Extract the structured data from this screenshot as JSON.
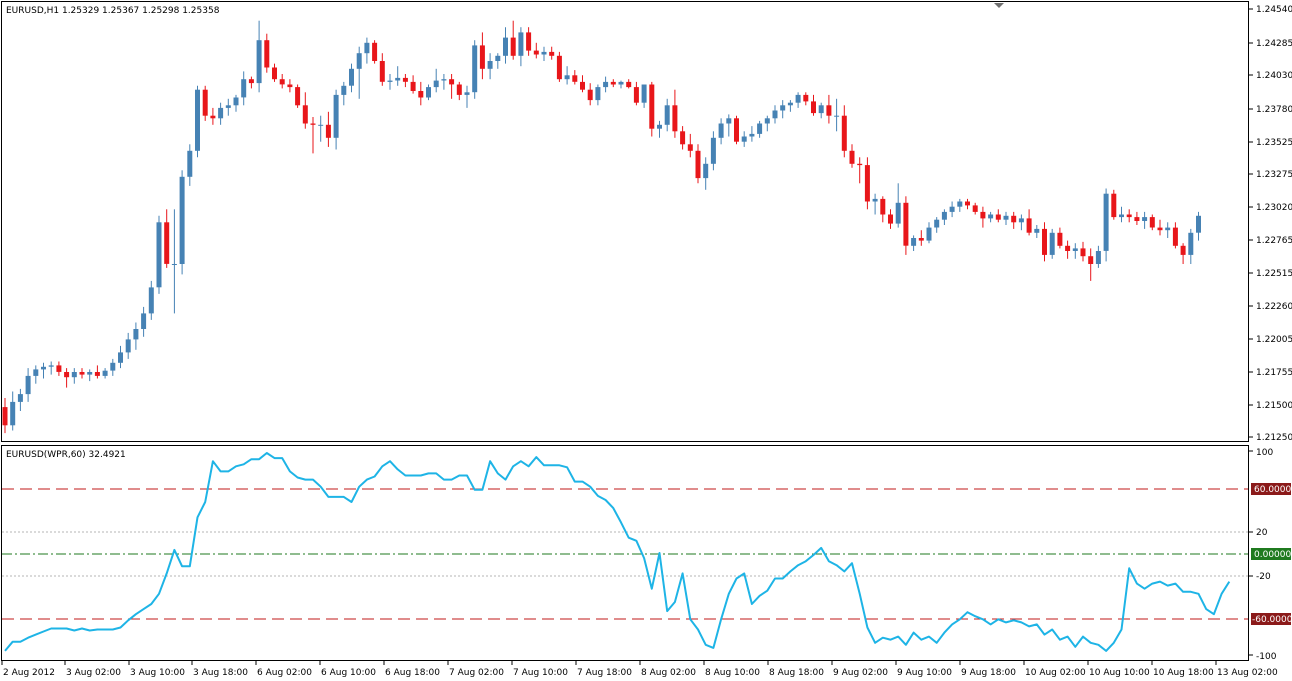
{
  "main_panel": {
    "label": "EURUSD,H1  1.25329 1.25367 1.25298 1.25358",
    "price_ticks": [
      "1.24540",
      "1.24285",
      "1.24030",
      "1.23780",
      "1.23525",
      "1.23275",
      "1.23020",
      "1.22765",
      "1.22515",
      "1.22260",
      "1.22005",
      "1.21755",
      "1.21500",
      "1.21250"
    ]
  },
  "indicator_panel": {
    "label": "EURUSD(WPR,60) 32.4921",
    "ticks": [
      "100",
      "20",
      "-20",
      "-100"
    ],
    "level_tags": [
      {
        "text": "60.0000",
        "value": 60,
        "color": "#8b1a1a"
      },
      {
        "text": "0.00000",
        "value": 0,
        "color": "#1f7a1f"
      },
      {
        "text": "-60.0000",
        "value": -60,
        "color": "#8b1a1a"
      }
    ]
  },
  "time_axis": [
    "2 Aug 2012",
    "3 Aug 02:00",
    "3 Aug 10:00",
    "3 Aug 18:00",
    "6 Aug 02:00",
    "6 Aug 10:00",
    "6 Aug 18:00",
    "7 Aug 02:00",
    "7 Aug 10:00",
    "7 Aug 18:00",
    "8 Aug 02:00",
    "8 Aug 10:00",
    "8 Aug 18:00",
    "9 Aug 02:00",
    "9 Aug 10:00",
    "9 Aug 18:00",
    "10 Aug 02:00",
    "10 Aug 10:00",
    "10 Aug 18:00",
    "13 Aug 02:00"
  ],
  "colors": {
    "bull": "#4682b4",
    "bear": "#e8161a",
    "wpr_line": "#1eb4e6",
    "level_red": "#c01818",
    "level_green": "#1f7a1f",
    "grid_dotted": "#b4b4b4",
    "frame": "#000000"
  },
  "chart_data": [
    {
      "type": "candlestick",
      "symbol": "EURUSD",
      "timeframe": "H1",
      "ylim": [
        1.2125,
        1.2454
      ],
      "x_labels": [
        "2 Aug 2012",
        "3 Aug 02:00",
        "3 Aug 10:00",
        "3 Aug 18:00",
        "6 Aug 02:00",
        "6 Aug 10:00",
        "6 Aug 18:00",
        "7 Aug 02:00",
        "7 Aug 10:00",
        "7 Aug 18:00",
        "8 Aug 02:00",
        "8 Aug 10:00",
        "8 Aug 18:00",
        "9 Aug 02:00",
        "9 Aug 10:00",
        "9 Aug 18:00",
        "10 Aug 02:00",
        "10 Aug 10:00",
        "10 Aug 18:00",
        "13 Aug 02:00"
      ],
      "ohlc": [
        [
          1.2148,
          1.2155,
          1.2128,
          1.2134
        ],
        [
          1.2134,
          1.216,
          1.213,
          1.2152
        ],
        [
          1.2152,
          1.2162,
          1.2145,
          1.2158
        ],
        [
          1.2158,
          1.2178,
          1.2152,
          1.2172
        ],
        [
          1.2172,
          1.218,
          1.2166,
          1.2177
        ],
        [
          1.2177,
          1.2182,
          1.217,
          1.2179
        ],
        [
          1.2179,
          1.2183,
          1.2173,
          1.218
        ],
        [
          1.218,
          1.2183,
          1.2172,
          1.2175
        ],
        [
          1.2175,
          1.2178,
          1.2163,
          1.2171
        ],
        [
          1.2171,
          1.2178,
          1.2166,
          1.2175
        ],
        [
          1.2175,
          1.2178,
          1.217,
          1.2173
        ],
        [
          1.2173,
          1.2177,
          1.2168,
          1.2175
        ],
        [
          1.2175,
          1.218,
          1.217,
          1.2172
        ],
        [
          1.2172,
          1.2178,
          1.217,
          1.2176
        ],
        [
          1.2176,
          1.2185,
          1.2172,
          1.2182
        ],
        [
          1.2182,
          1.2195,
          1.2178,
          1.219
        ],
        [
          1.219,
          1.2205,
          1.2185,
          1.22
        ],
        [
          1.22,
          1.2213,
          1.2192,
          1.2208
        ],
        [
          1.2208,
          1.2225,
          1.2202,
          1.222
        ],
        [
          1.222,
          1.2245,
          1.2215,
          1.224
        ],
        [
          1.224,
          1.2295,
          1.2235,
          1.229
        ],
        [
          1.229,
          1.23,
          1.2255,
          1.2258
        ],
        [
          1.2258,
          1.23,
          1.222,
          1.2258
        ],
        [
          1.2258,
          1.233,
          1.225,
          1.2325
        ],
        [
          1.2325,
          1.235,
          1.2318,
          1.2345
        ],
        [
          1.2345,
          1.2395,
          1.234,
          1.2392
        ],
        [
          1.2392,
          1.2395,
          1.2368,
          1.2372
        ],
        [
          1.2372,
          1.2378,
          1.2365,
          1.237
        ],
        [
          1.237,
          1.2382,
          1.2365,
          1.2378
        ],
        [
          1.2378,
          1.2385,
          1.2372,
          1.238
        ],
        [
          1.238,
          1.2388,
          1.2375,
          1.2386
        ],
        [
          1.2386,
          1.2406,
          1.238,
          1.24
        ],
        [
          1.24,
          1.2402,
          1.2393,
          1.2397
        ],
        [
          1.2397,
          1.2445,
          1.239,
          1.243
        ],
        [
          1.243,
          1.2435,
          1.2405,
          1.2409
        ],
        [
          1.2409,
          1.2412,
          1.2398,
          1.24
        ],
        [
          1.24,
          1.2404,
          1.2393,
          1.2396
        ],
        [
          1.2396,
          1.24,
          1.239,
          1.2394
        ],
        [
          1.2394,
          1.2396,
          1.2378,
          1.238
        ],
        [
          1.238,
          1.239,
          1.2362,
          1.2366
        ],
        [
          1.2366,
          1.2371,
          1.2343,
          1.2365
        ],
        [
          1.2365,
          1.2372,
          1.2352,
          1.2365
        ],
        [
          1.2365,
          1.2375,
          1.2348,
          1.2355
        ],
        [
          1.2355,
          1.2392,
          1.2346,
          1.2388
        ],
        [
          1.2388,
          1.2398,
          1.238,
          1.2395
        ],
        [
          1.2395,
          1.2412,
          1.239,
          1.2408
        ],
        [
          1.2408,
          1.2425,
          1.2385,
          1.242
        ],
        [
          1.242,
          1.2432,
          1.2412,
          1.2428
        ],
        [
          1.2428,
          1.243,
          1.2412,
          1.2414
        ],
        [
          1.2414,
          1.242,
          1.2395,
          1.2398
        ],
        [
          1.2398,
          1.2404,
          1.2392,
          1.2399
        ],
        [
          1.2399,
          1.241,
          1.2395,
          1.2401
        ],
        [
          1.2401,
          1.2404,
          1.2394,
          1.2398
        ],
        [
          1.2398,
          1.2403,
          1.2389,
          1.2391
        ],
        [
          1.2391,
          1.2398,
          1.238,
          1.2386
        ],
        [
          1.2386,
          1.2396,
          1.2384,
          1.2394
        ],
        [
          1.2394,
          1.2408,
          1.239,
          1.2399
        ],
        [
          1.2399,
          1.2404,
          1.2392,
          1.24
        ],
        [
          1.24,
          1.2404,
          1.2385,
          1.2396
        ],
        [
          1.2396,
          1.2398,
          1.2384,
          1.2388
        ],
        [
          1.2388,
          1.2395,
          1.2378,
          1.239
        ],
        [
          1.239,
          1.243,
          1.2385,
          1.2426
        ],
        [
          1.2426,
          1.2436,
          1.24,
          1.2408
        ],
        [
          1.2408,
          1.242,
          1.24,
          1.2414
        ],
        [
          1.2414,
          1.242,
          1.2408,
          1.2418
        ],
        [
          1.2418,
          1.244,
          1.2412,
          1.2432
        ],
        [
          1.2432,
          1.2445,
          1.2415,
          1.2418
        ],
        [
          1.2418,
          1.244,
          1.241,
          1.2436
        ],
        [
          1.2436,
          1.244,
          1.2418,
          1.2422
        ],
        [
          1.2422,
          1.2428,
          1.2416,
          1.2419
        ],
        [
          1.2419,
          1.2425,
          1.2414,
          1.2421
        ],
        [
          1.2421,
          1.2425,
          1.2415,
          1.2418
        ],
        [
          1.2418,
          1.2421,
          1.2398,
          1.24
        ],
        [
          1.24,
          1.241,
          1.2396,
          1.2403
        ],
        [
          1.2403,
          1.2407,
          1.2396,
          1.2398
        ],
        [
          1.2398,
          1.2403,
          1.239,
          1.2392
        ],
        [
          1.2392,
          1.2397,
          1.238,
          1.2384
        ],
        [
          1.2384,
          1.2396,
          1.238,
          1.2394
        ],
        [
          1.2394,
          1.2402,
          1.239,
          1.2398
        ],
        [
          1.2398,
          1.24,
          1.2394,
          1.2396
        ],
        [
          1.2396,
          1.2399,
          1.2393,
          1.2398
        ],
        [
          1.2398,
          1.24,
          1.2393,
          1.2394
        ],
        [
          1.2394,
          1.2398,
          1.238,
          1.2382
        ],
        [
          1.2382,
          1.2396,
          1.2378,
          1.2396
        ],
        [
          1.2396,
          1.2398,
          1.2356,
          1.2362
        ],
        [
          1.2362,
          1.2368,
          1.2355,
          1.2365
        ],
        [
          1.2365,
          1.2385,
          1.236,
          1.238
        ],
        [
          1.238,
          1.2392,
          1.2355,
          1.236
        ],
        [
          1.236,
          1.2364,
          1.2346,
          1.235
        ],
        [
          1.235,
          1.2358,
          1.234,
          1.2345
        ],
        [
          1.2345,
          1.235,
          1.232,
          1.2324
        ],
        [
          1.2324,
          1.234,
          1.2315,
          1.2335
        ],
        [
          1.2335,
          1.236,
          1.233,
          1.2355
        ],
        [
          1.2355,
          1.237,
          1.235,
          1.2366
        ],
        [
          1.2366,
          1.2373,
          1.2356,
          1.237
        ],
        [
          1.237,
          1.2372,
          1.235,
          1.2352
        ],
        [
          1.2352,
          1.236,
          1.2348,
          1.2356
        ],
        [
          1.2356,
          1.2364,
          1.2352,
          1.2358
        ],
        [
          1.2358,
          1.2368,
          1.2355,
          1.2366
        ],
        [
          1.2366,
          1.2372,
          1.236,
          1.237
        ],
        [
          1.237,
          1.238,
          1.2366,
          1.2376
        ],
        [
          1.2376,
          1.2384,
          1.237,
          1.238
        ],
        [
          1.238,
          1.2384,
          1.2375,
          1.2382
        ],
        [
          1.2382,
          1.239,
          1.2378,
          1.2388
        ],
        [
          1.2388,
          1.239,
          1.238,
          1.2383
        ],
        [
          1.2383,
          1.2388,
          1.2372,
          1.2374
        ],
        [
          1.2374,
          1.2382,
          1.237,
          1.238
        ],
        [
          1.238,
          1.2388,
          1.2366,
          1.2372
        ],
        [
          1.2372,
          1.2385,
          1.236,
          1.2372
        ],
        [
          1.2372,
          1.238,
          1.234,
          1.2345
        ],
        [
          1.2345,
          1.235,
          1.2332,
          1.2335
        ],
        [
          1.2335,
          1.234,
          1.232,
          1.2334
        ],
        [
          1.2334,
          1.234,
          1.23,
          1.2306
        ],
        [
          1.2306,
          1.2312,
          1.2296,
          1.2308
        ],
        [
          1.2308,
          1.231,
          1.229,
          1.2296
        ],
        [
          1.2296,
          1.23,
          1.2285,
          1.2289
        ],
        [
          1.2289,
          1.232,
          1.2286,
          1.2305
        ],
        [
          1.2305,
          1.231,
          1.2265,
          1.2272
        ],
        [
          1.2272,
          1.228,
          1.2268,
          1.2278
        ],
        [
          1.2278,
          1.2284,
          1.2272,
          1.2276
        ],
        [
          1.2276,
          1.229,
          1.2274,
          1.2286
        ],
        [
          1.2286,
          1.2294,
          1.2282,
          1.2292
        ],
        [
          1.2292,
          1.23,
          1.2288,
          1.2298
        ],
        [
          1.2298,
          1.2306,
          1.2294,
          1.2302
        ],
        [
          1.2302,
          1.2308,
          1.2298,
          1.2306
        ],
        [
          1.2306,
          1.2308,
          1.23,
          1.2303
        ],
        [
          1.2303,
          1.2305,
          1.2296,
          1.2298
        ],
        [
          1.2298,
          1.2302,
          1.2286,
          1.2293
        ],
        [
          1.2293,
          1.2298,
          1.229,
          1.2296
        ],
        [
          1.2296,
          1.23,
          1.229,
          1.2292
        ],
        [
          1.2292,
          1.2298,
          1.2288,
          1.2295
        ],
        [
          1.2295,
          1.2298,
          1.2285,
          1.229
        ],
        [
          1.229,
          1.2296,
          1.2284,
          1.2293
        ],
        [
          1.2293,
          1.23,
          1.228,
          1.2282
        ],
        [
          1.2282,
          1.2288,
          1.2278,
          1.2285
        ],
        [
          1.2285,
          1.229,
          1.226,
          1.2265
        ],
        [
          1.2265,
          1.2285,
          1.2262,
          1.2282
        ],
        [
          1.2282,
          1.2286,
          1.227,
          1.2272
        ],
        [
          1.2272,
          1.2276,
          1.2262,
          1.2268
        ],
        [
          1.2268,
          1.2274,
          1.2262,
          1.227
        ],
        [
          1.227,
          1.2275,
          1.226,
          1.2264
        ],
        [
          1.2264,
          1.227,
          1.2245,
          1.2258
        ],
        [
          1.2258,
          1.2272,
          1.2255,
          1.2268
        ],
        [
          1.2268,
          1.2316,
          1.226,
          1.2312
        ],
        [
          1.2312,
          1.2315,
          1.2292,
          1.2294
        ],
        [
          1.2294,
          1.2302,
          1.229,
          1.2296
        ],
        [
          1.2296,
          1.23,
          1.229,
          1.2294
        ],
        [
          1.2294,
          1.2298,
          1.2288,
          1.2291
        ],
        [
          1.2291,
          1.2298,
          1.2285,
          1.2294
        ],
        [
          1.2294,
          1.2296,
          1.2284,
          1.2286
        ],
        [
          1.2286,
          1.2292,
          1.228,
          1.2284
        ],
        [
          1.2284,
          1.229,
          1.2278,
          1.2286
        ],
        [
          1.2286,
          1.229,
          1.227,
          1.2272
        ],
        [
          1.2272,
          1.2274,
          1.2258,
          1.2265
        ],
        [
          1.2265,
          1.2285,
          1.2258,
          1.2282
        ],
        [
          1.2282,
          1.2298,
          1.2276,
          1.2295
        ]
      ]
    },
    {
      "type": "line",
      "name": "WPR(60)",
      "ylim": [
        -100,
        100
      ],
      "levels": [
        60,
        0,
        -60
      ],
      "values": [
        -96,
        -87,
        -87,
        -83,
        -80,
        -77,
        -74,
        -74,
        -74,
        -76,
        -74,
        -76,
        -75,
        -75,
        -75,
        -73,
        -66,
        -60,
        -55,
        -50,
        -40,
        -20,
        3,
        -13,
        -13,
        35,
        50,
        90,
        80,
        80,
        85,
        87,
        92,
        92,
        98,
        93,
        93,
        80,
        74,
        72,
        72,
        65,
        55,
        55,
        55,
        50,
        65,
        72,
        75,
        85,
        90,
        82,
        76,
        76,
        76,
        78,
        78,
        72,
        72,
        76,
        76,
        62,
        62,
        90,
        78,
        72,
        85,
        90,
        85,
        94,
        86,
        86,
        86,
        84,
        70,
        70,
        65,
        56,
        52,
        44,
        30,
        15,
        12,
        -5,
        -35,
        0,
        -57,
        -48,
        -20,
        -65,
        -75,
        -90,
        -93,
        -65,
        -40,
        -25,
        -20,
        -50,
        -42,
        -37,
        -25,
        -25,
        -18,
        -12,
        -8,
        -2,
        5,
        -8,
        -12,
        -18,
        -10,
        -40,
        -73,
        -88,
        -83,
        -85,
        -82,
        -90,
        -78,
        -85,
        -82,
        -88,
        -78,
        -70,
        -65,
        -58,
        -62,
        -65,
        -70,
        -65,
        -68,
        -66,
        -68,
        -72,
        -70,
        -80,
        -75,
        -85,
        -82,
        -92,
        -82,
        -88,
        -90,
        -96,
        -88,
        -75,
        -15,
        -30,
        -35,
        -30,
        -28,
        -32,
        -30,
        -38,
        -38,
        -40,
        -55,
        -60,
        -40,
        -28
      ]
    }
  ]
}
